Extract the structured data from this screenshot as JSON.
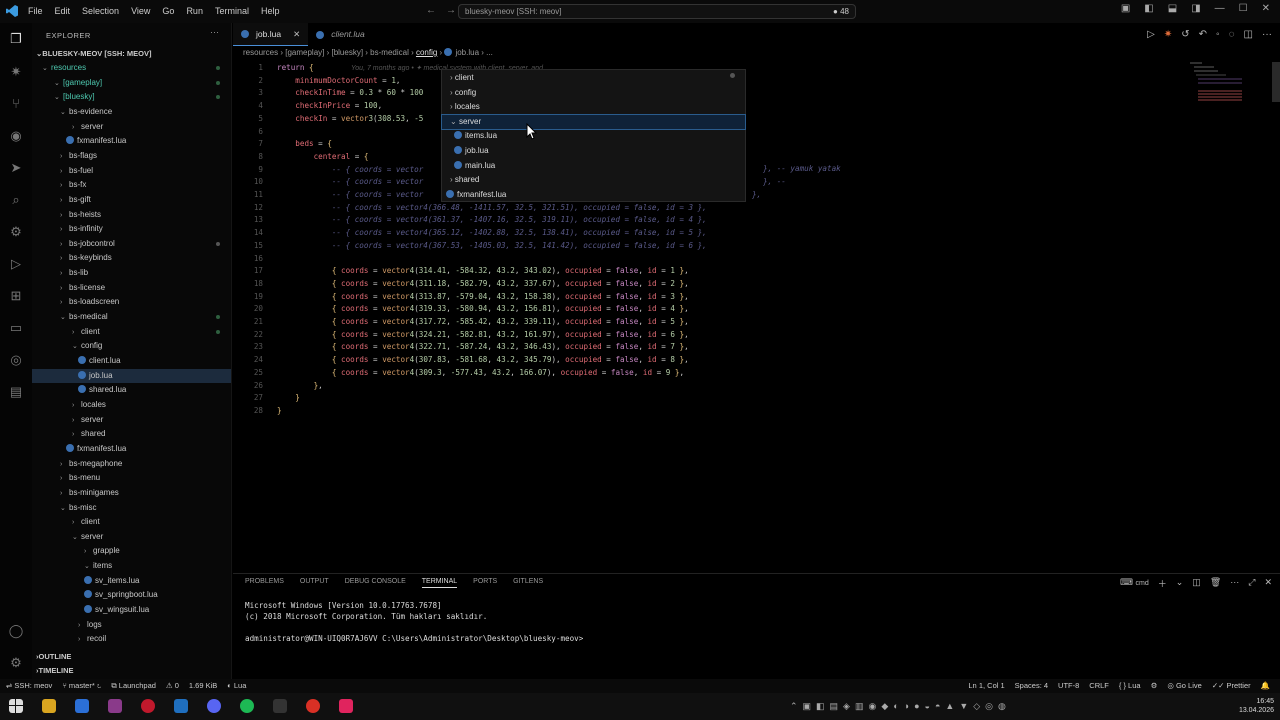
{
  "titlebar": {
    "menu": [
      "File",
      "Edit",
      "Selection",
      "View",
      "Go",
      "Run",
      "Terminal",
      "Help"
    ],
    "search": "bluesky-meov [SSH: meov]",
    "badge": "● 48"
  },
  "sidebar": {
    "title": "EXPLORER",
    "root": "BLUESKY-MEOV [SSH: MEOV]",
    "tree": [
      {
        "label": "resources",
        "color": "#4ec9b0"
      },
      {
        "label": "[gameplay]",
        "color": "#4ec9b0"
      },
      {
        "label": "[bluesky]",
        "color": "#4ec9b0"
      },
      {
        "label": "bs-evidence",
        "color": "#c8c8c8"
      },
      {
        "label": "server",
        "color": "#c8c8c8"
      },
      {
        "label": "fxmanifest.lua",
        "color": "#c8c8c8"
      },
      {
        "label": "bs-flags",
        "color": "#c8c8c8"
      },
      {
        "label": "bs-fuel",
        "color": "#c8c8c8"
      },
      {
        "label": "bs-fx",
        "color": "#c8c8c8"
      },
      {
        "label": "bs-gift",
        "color": "#c8c8c8"
      },
      {
        "label": "bs-heists",
        "color": "#c8c8c8"
      },
      {
        "label": "bs-infinity",
        "color": "#c8c8c8"
      },
      {
        "label": "bs-jobcontrol",
        "color": "#c8c8c8"
      },
      {
        "label": "bs-keybinds",
        "color": "#c8c8c8"
      },
      {
        "label": "bs-lib",
        "color": "#c8c8c8"
      },
      {
        "label": "bs-license",
        "color": "#c8c8c8"
      },
      {
        "label": "bs-loadscreen",
        "color": "#c8c8c8"
      },
      {
        "label": "bs-medical",
        "color": "#c8c8c8"
      },
      {
        "label": "client",
        "color": "#c8c8c8"
      },
      {
        "label": "config",
        "color": "#c8c8c8"
      },
      {
        "label": "client.lua",
        "color": "#c8c8c8"
      },
      {
        "label": "job.lua",
        "color": "#c8c8c8"
      },
      {
        "label": "shared.lua",
        "color": "#c8c8c8"
      },
      {
        "label": "locales",
        "color": "#c8c8c8"
      },
      {
        "label": "server",
        "color": "#c8c8c8"
      },
      {
        "label": "shared",
        "color": "#c8c8c8"
      },
      {
        "label": "fxmanifest.lua",
        "color": "#c8c8c8"
      },
      {
        "label": "bs-megaphone",
        "color": "#c8c8c8"
      },
      {
        "label": "bs-menu",
        "color": "#c8c8c8"
      },
      {
        "label": "bs-minigames",
        "color": "#c8c8c8"
      },
      {
        "label": "bs-misc",
        "color": "#c8c8c8"
      },
      {
        "label": "client",
        "color": "#c8c8c8"
      },
      {
        "label": "server",
        "color": "#c8c8c8"
      },
      {
        "label": "grapple",
        "color": "#c8c8c8"
      },
      {
        "label": "items",
        "color": "#c8c8c8"
      },
      {
        "label": "sv_items.lua",
        "color": "#c8c8c8"
      },
      {
        "label": "sv_springboot.lua",
        "color": "#c8c8c8"
      },
      {
        "label": "sv_wingsuit.lua",
        "color": "#c8c8c8"
      },
      {
        "label": "logs",
        "color": "#c8c8c8"
      },
      {
        "label": "recoil",
        "color": "#c8c8c8"
      }
    ],
    "outline": "OUTLINE",
    "timeline": "TIMELINE"
  },
  "tabs": [
    {
      "label": "job.lua",
      "active": true
    },
    {
      "label": "client.lua",
      "active": false
    }
  ],
  "breadcrumb": [
    "resources",
    "[gameplay]",
    "[bluesky]",
    "bs-medical",
    "config",
    "job.lua",
    "..."
  ],
  "code": [
    {
      "n": "1",
      "t": "return {"
    },
    {
      "n": "2",
      "t": "    minimumDoctorCount = 1,"
    },
    {
      "n": "3",
      "t": "    checkInTime = 0.3 * 60 * 100"
    },
    {
      "n": "4",
      "t": "    checkInPrice = 100,"
    },
    {
      "n": "5",
      "t": "    checkIn = vector3(308.53, -5"
    },
    {
      "n": "6",
      "t": ""
    },
    {
      "n": "7",
      "t": "    beds = {"
    },
    {
      "n": "8",
      "t": "        centeral = {"
    },
    {
      "n": "9",
      "t": "            -- { coords = vector"
    },
    {
      "n": "10",
      "t": "            -- { coords = vector"
    },
    {
      "n": "11",
      "t": "            -- { coords = vector"
    },
    {
      "n": "12",
      "t": "            -- { coords = vector4(366.48, -1411.57, 32.5, 321.51), occupied = false, id = 3 },"
    },
    {
      "n": "13",
      "t": "            -- { coords = vector4(361.37, -1407.16, 32.5, 319.11), occupied = false, id = 4 },"
    },
    {
      "n": "14",
      "t": "            -- { coords = vector4(365.12, -1402.88, 32.5, 138.41), occupied = false, id = 5 },"
    },
    {
      "n": "15",
      "t": "            -- { coords = vector4(367.53, -1405.03, 32.5, 141.42), occupied = false, id = 6 },"
    },
    {
      "n": "16",
      "t": ""
    },
    {
      "n": "17",
      "t": "            { coords = vector4(314.41, -584.32, 43.2, 343.02), occupied = false, id = 1 },"
    },
    {
      "n": "18",
      "t": "            { coords = vector4(311.18, -582.79, 43.2, 337.67), occupied = false, id = 2 },"
    },
    {
      "n": "19",
      "t": "            { coords = vector4(313.87, -579.04, 43.2, 158.38), occupied = false, id = 3 },"
    },
    {
      "n": "20",
      "t": "            { coords = vector4(319.33, -580.94, 43.2, 156.81), occupied = false, id = 4 },"
    },
    {
      "n": "21",
      "t": "            { coords = vector4(317.72, -585.42, 43.2, 339.11), occupied = false, id = 5 },"
    },
    {
      "n": "22",
      "t": "            { coords = vector4(324.21, -582.81, 43.2, 161.97), occupied = false, id = 6 },"
    },
    {
      "n": "23",
      "t": "            { coords = vector4(322.71, -587.24, 43.2, 346.43), occupied = false, id = 7 },"
    },
    {
      "n": "24",
      "t": "            { coords = vector4(307.83, -581.68, 43.2, 345.79), occupied = false, id = 8 },"
    },
    {
      "n": "25",
      "t": "            { coords = vector4(309.3, -577.43, 43.2, 166.07), occupied = false, id = 9 },"
    },
    {
      "n": "26",
      "t": "        },"
    },
    {
      "n": "27",
      "t": "    }"
    },
    {
      "n": "28",
      "t": "}"
    }
  ],
  "blame": "You, 7 months ago • ✦ medical system with client, server, and",
  "comment_tail": [
    "}, -- yamuk yatak",
    "}, --",
    "},"
  ],
  "popup": [
    {
      "label": "client",
      "kind": "folder-closed"
    },
    {
      "label": "config",
      "kind": "folder-closed"
    },
    {
      "label": "locales",
      "kind": "folder-closed"
    },
    {
      "label": "server",
      "kind": "folder-open"
    },
    {
      "label": "items.lua",
      "kind": "file"
    },
    {
      "label": "job.lua",
      "kind": "file"
    },
    {
      "label": "main.lua",
      "kind": "file"
    },
    {
      "label": "shared",
      "kind": "folder-closed"
    },
    {
      "label": "fxmanifest.lua",
      "kind": "file"
    }
  ],
  "panel": {
    "tabs": [
      "PROBLEMS",
      "OUTPUT",
      "DEBUG CONSOLE",
      "TERMINAL",
      "PORTS",
      "GITLENS"
    ],
    "active_tab": "TERMINAL",
    "shell": "cmd",
    "terminal": [
      "Microsoft Windows [Version 10.0.17763.7678]",
      "(c) 2018 Microsoft Corporation. Tüm hakları saklıdır.",
      "",
      "administrator@WIN-UIQ0R7AJ6VV C:\\Users\\Administrator\\Desktop\\bluesky-meov>"
    ]
  },
  "status": {
    "remote": "SSH: meov",
    "branch": "master*",
    "launchpad": "Launchpad",
    "warnings": "0",
    "size": "1.69 KiB",
    "lang_left": "Lua",
    "position": "Ln 1, Col 1",
    "spaces": "Spaces: 4",
    "encoding": "UTF-8",
    "eol": "CRLF",
    "lang": "{ } Lua",
    "golive": "Go Live",
    "prettier": "Prettier"
  },
  "taskbar": {
    "time": "16:45",
    "date": "13.04.2026"
  }
}
